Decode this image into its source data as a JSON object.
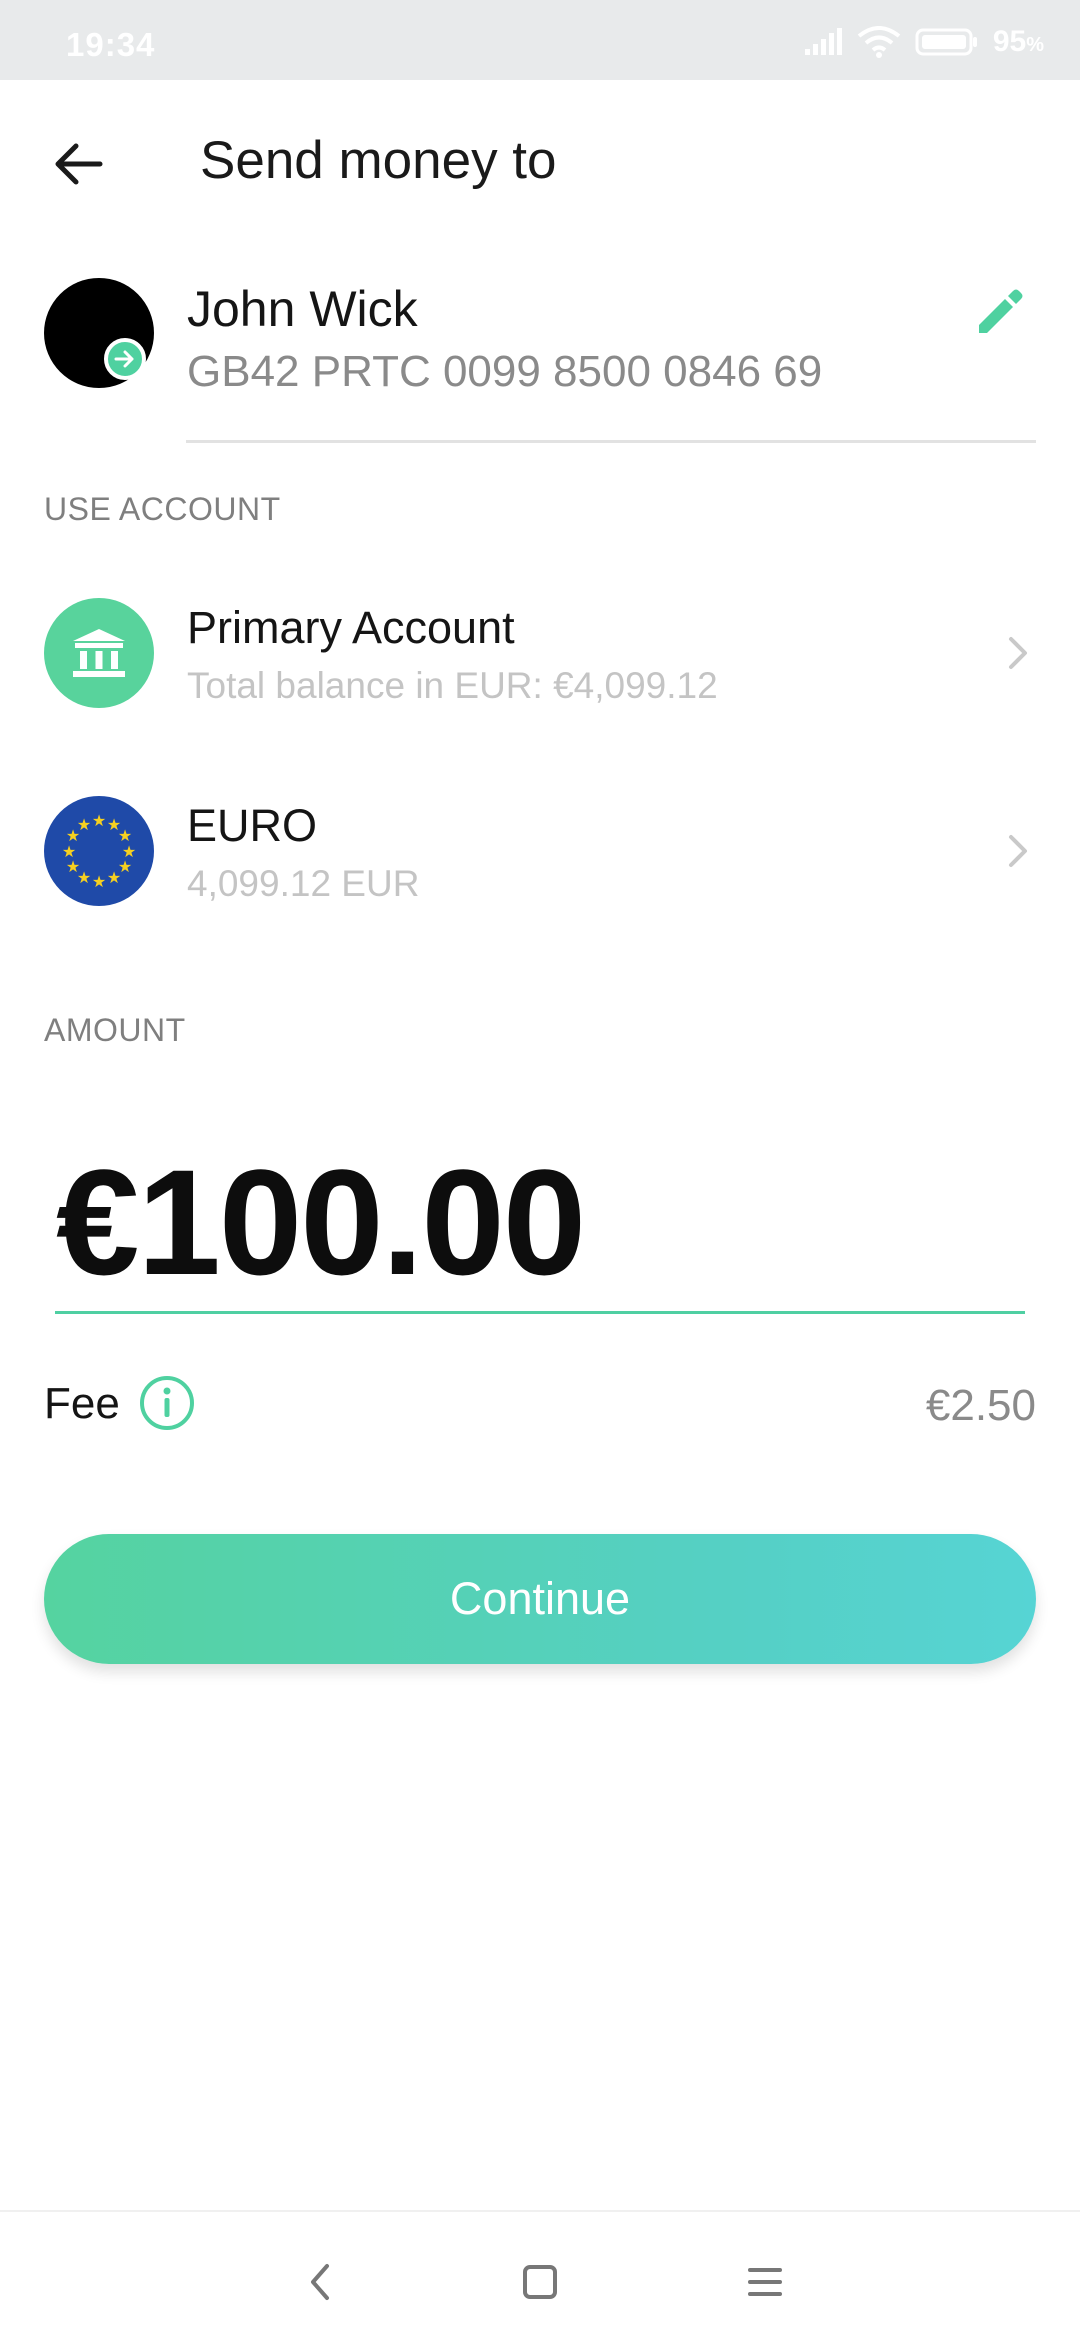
{
  "status_bar": {
    "time": "19:34",
    "battery_percent": "95",
    "battery_unit": "%"
  },
  "header": {
    "title": "Send money to"
  },
  "recipient": {
    "name": "John Wick",
    "iban": "GB42 PRTC 0099 8500 0846 69"
  },
  "use_account": {
    "label": "USE ACCOUNT",
    "accounts": [
      {
        "title": "Primary Account",
        "subtitle": "Total balance in EUR: €4,099.12",
        "icon": "bank-icon"
      },
      {
        "title": "EURO",
        "subtitle": "4,099.12 EUR",
        "icon": "eu-flag-icon"
      }
    ]
  },
  "amount": {
    "label": "AMOUNT",
    "value": "€100.00"
  },
  "fee": {
    "label": "Fee",
    "value": "€2.50"
  },
  "continue_label": "Continue",
  "colors": {
    "accent": "#4fd1a0",
    "eu_blue": "#1f4aa8",
    "eu_gold": "#f5d020"
  }
}
